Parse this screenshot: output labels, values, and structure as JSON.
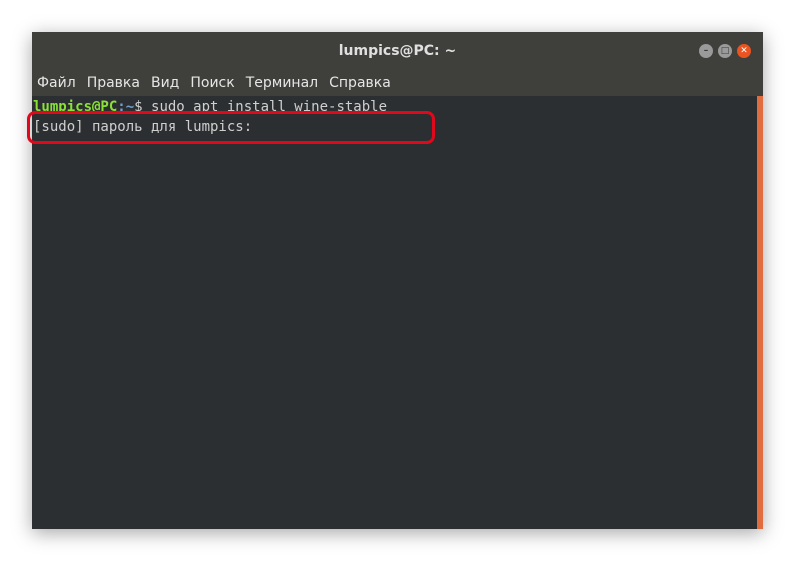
{
  "window": {
    "title": "lumpics@PC: ~"
  },
  "menu": {
    "items": [
      "Файл",
      "Правка",
      "Вид",
      "Поиск",
      "Терминал",
      "Справка"
    ]
  },
  "terminal": {
    "prompt_user": "lumpics@PC",
    "prompt_path": ":~",
    "prompt_suffix": "$ ",
    "command": "sudo apt install wine-stable",
    "output_line": "[sudo] пароль для lumpics:"
  },
  "colors": {
    "prompt_user": "#8ae234",
    "prompt_path": "#729fcf",
    "close_button": "#e95420",
    "highlight": "#e1081b",
    "scrollbar": "#e06c3f"
  },
  "icons": {
    "minimize": "minimize-icon",
    "maximize": "maximize-icon",
    "close": "close-icon"
  }
}
